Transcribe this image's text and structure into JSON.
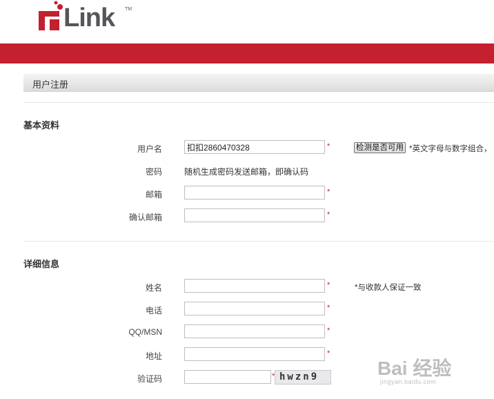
{
  "brand": {
    "logo_text": "Link",
    "tm": "TM",
    "accent": "#c4202f"
  },
  "header": {
    "title": "用户注册"
  },
  "basic": {
    "title": "基本资料",
    "username_label": "用户名",
    "username_value": "扣扣2860470328",
    "check_button": "检测是否可用",
    "username_note": "*英文字母与数字组合，",
    "password_label": "密码",
    "password_text": "随机生成密码发送邮箱，即确认码",
    "email_label": "邮箱",
    "email_confirm_label": "确认邮箱"
  },
  "detail": {
    "title": "详细信息",
    "name_label": "姓名",
    "name_note": "*与收款人保证一致",
    "phone_label": "电话",
    "qq_label": "QQ/MSN",
    "address_label": "地址",
    "captcha_label": "验证码",
    "captcha_text": "hwzn9"
  },
  "required_mark": "*",
  "watermark": {
    "main": "Bai 经验",
    "sub": "jingyan.baidu.com"
  }
}
